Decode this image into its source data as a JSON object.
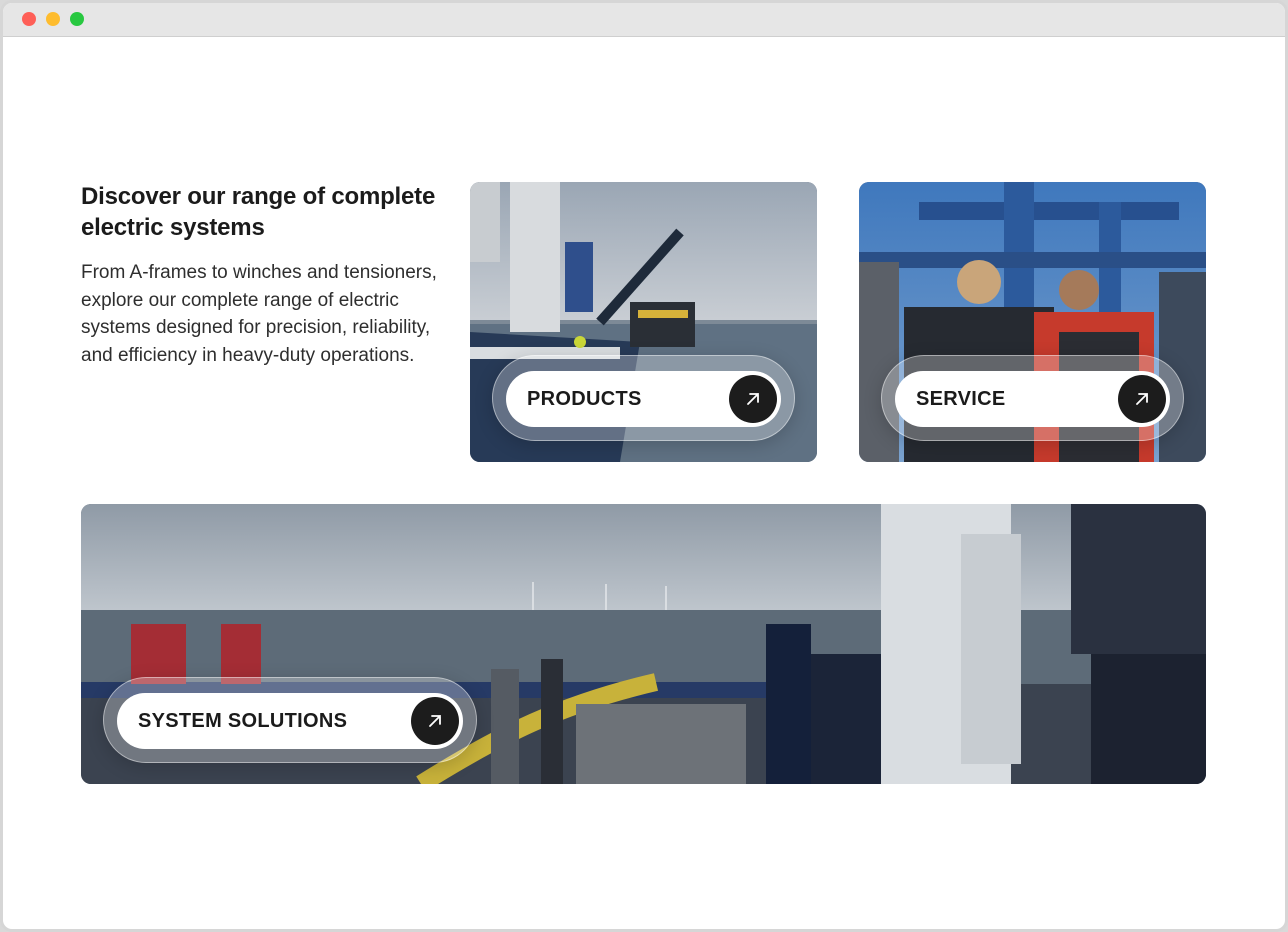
{
  "intro": {
    "heading": "Discover our range of complete electric systems",
    "body": "From A-frames to winches and tensioners, explore our complete range of electric systems designed for precision, reliability, and efficiency in heavy-duty operations."
  },
  "cards": [
    {
      "id": "products",
      "label": "PRODUCTS",
      "icon": "arrow-up-right-icon"
    },
    {
      "id": "service",
      "label": "SERVICE",
      "icon": "arrow-up-right-icon"
    },
    {
      "id": "system-solutions",
      "label": "SYSTEM SOLUTIONS",
      "icon": "arrow-up-right-icon"
    }
  ],
  "colors": {
    "accent_dark": "#1c1c1c",
    "text": "#1b1b1b",
    "window_close": "#fe5f57",
    "window_minimize": "#febc2e",
    "window_zoom": "#28c840"
  }
}
